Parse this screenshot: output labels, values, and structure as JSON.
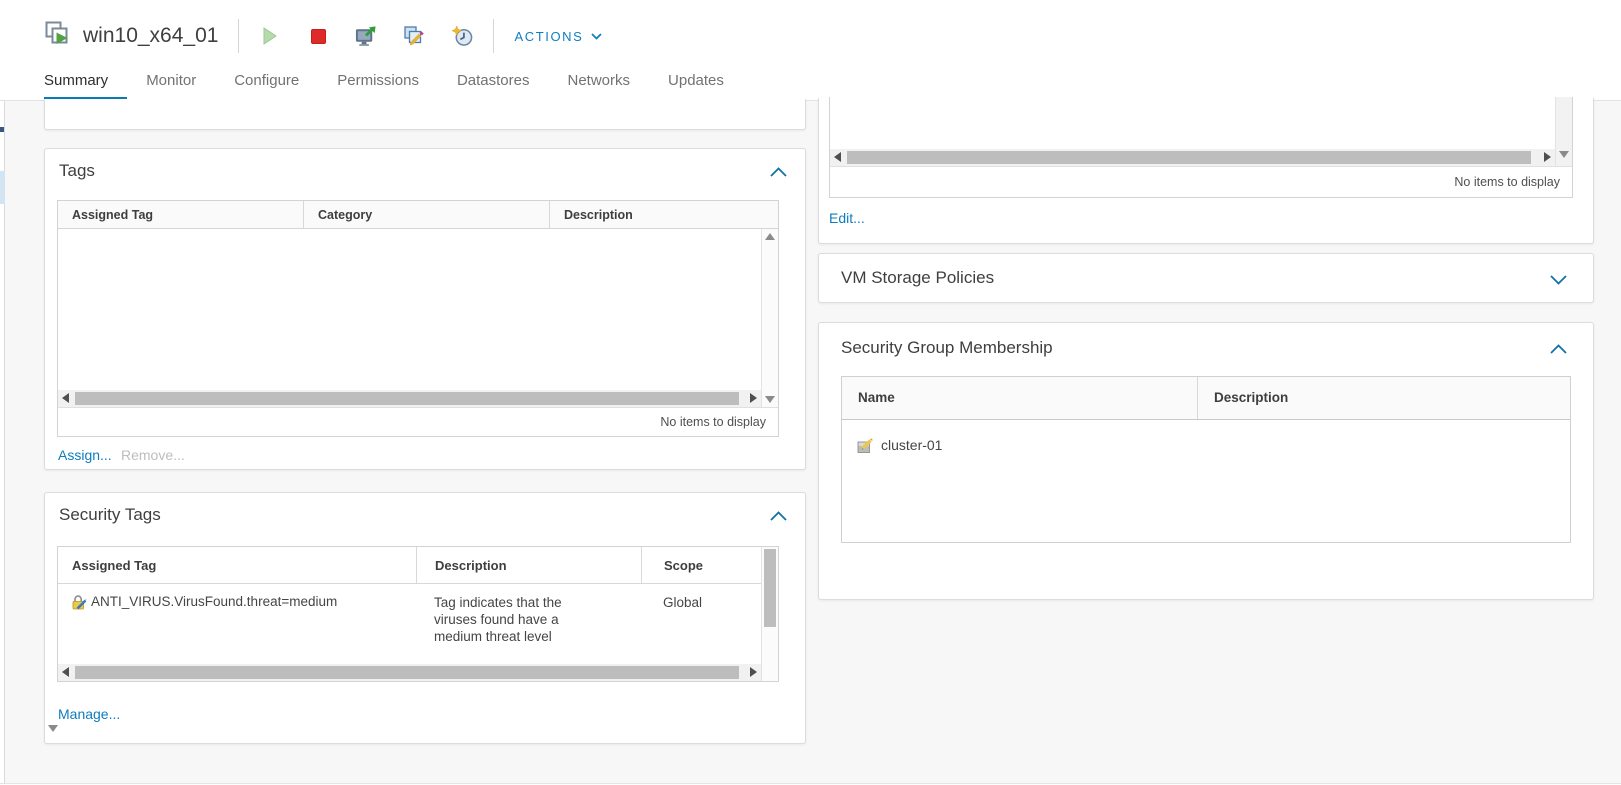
{
  "header": {
    "vm_name": "win10_x64_01",
    "actions_label": "ACTIONS"
  },
  "tabs": {
    "items": [
      "Summary",
      "Monitor",
      "Configure",
      "Permissions",
      "Datastores",
      "Networks",
      "Updates"
    ],
    "active": "Summary"
  },
  "left_column": {
    "tags": {
      "title": "Tags",
      "columns": [
        "Assigned Tag",
        "Category",
        "Description"
      ],
      "rows": [],
      "empty_text": "No items to display",
      "actions": {
        "assign": "Assign...",
        "remove": "Remove..."
      }
    },
    "security_tags": {
      "title": "Security Tags",
      "columns": [
        "Assigned Tag",
        "Description",
        "Scope"
      ],
      "rows": [
        {
          "assigned_tag": "ANTI_VIRUS.VirusFound.threat=medium",
          "description": "Tag indicates that the viruses found have a medium threat level",
          "scope": "Global"
        }
      ],
      "actions": {
        "manage": "Manage..."
      }
    }
  },
  "right_column": {
    "truncated_panel": {
      "empty_text": "No items to display",
      "actions": {
        "edit": "Edit..."
      }
    },
    "vm_storage_policies": {
      "title": "VM Storage Policies",
      "collapsed": true
    },
    "security_group_membership": {
      "title": "Security Group Membership",
      "columns": [
        "Name",
        "Description"
      ],
      "rows": [
        {
          "name": "cluster-01",
          "description": ""
        }
      ]
    }
  },
  "icons": {
    "vm": "overlapping-squares-with-green-play",
    "power_on": "pale-green-play-triangle",
    "power_off": "red-stop-square",
    "launch_console": "monitor-with-green-arrow",
    "edit_settings": "blue-pages-with-pencil",
    "snapshot": "clock-with-star",
    "collapse": "chevron-up",
    "expand": "chevron-down",
    "security_tag": "yellow-lock-with-blue-pencil",
    "security_group": "gray-note-with-yellow-pencil"
  },
  "colors": {
    "accent_blue": "#0c7bb3",
    "link_blue": "#0e7dbd",
    "stop_red": "#df2a2a",
    "play_green": "#abd8a1",
    "page_bg": "#f7f7f7"
  }
}
